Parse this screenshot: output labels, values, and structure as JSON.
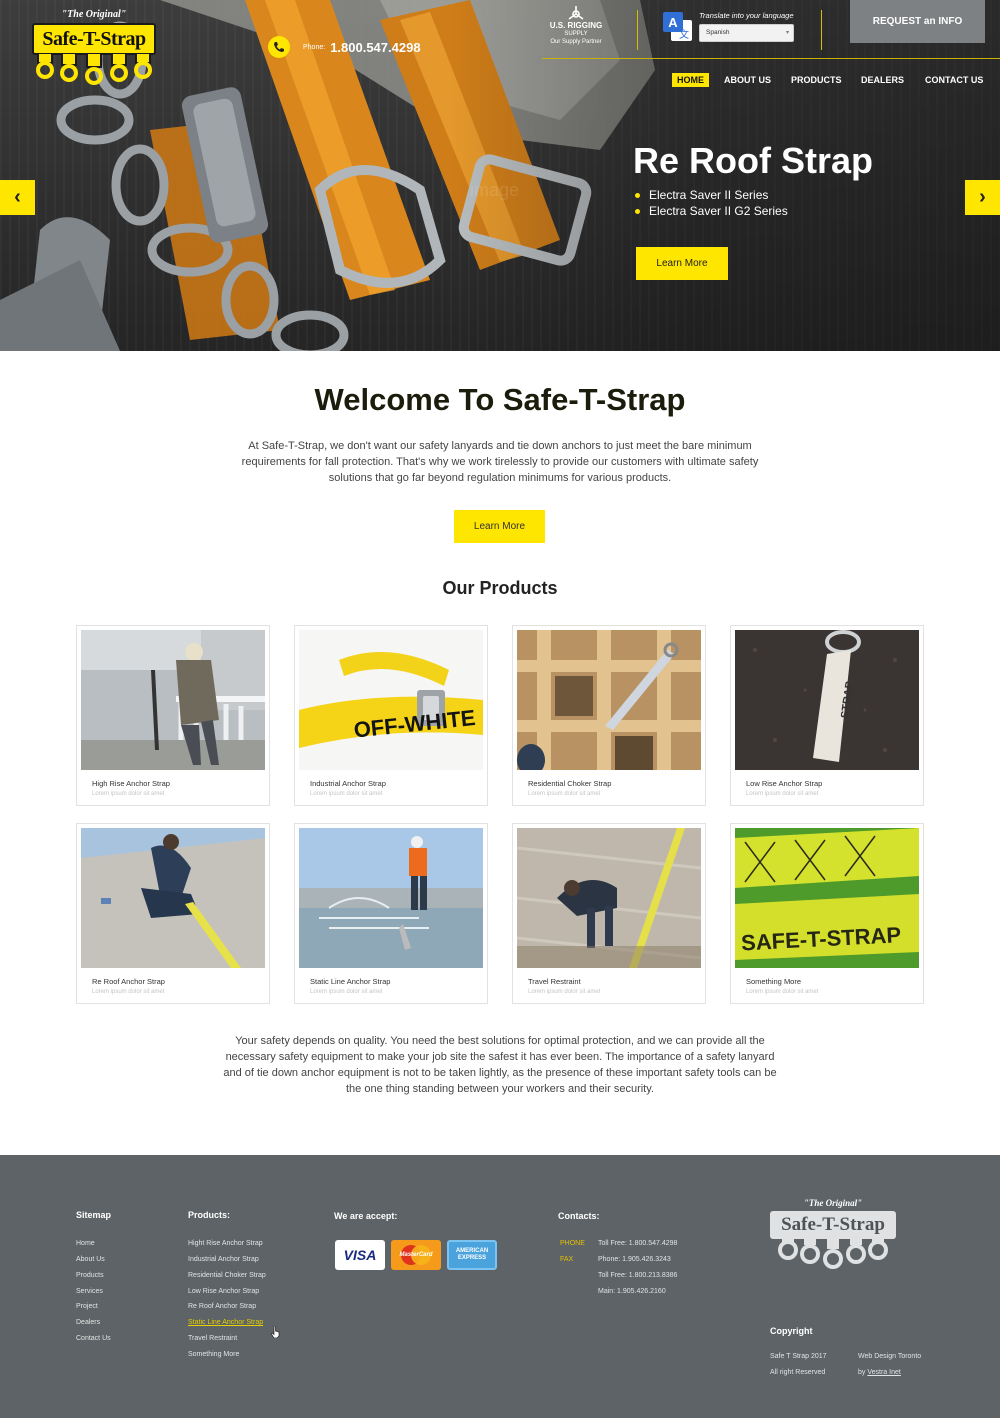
{
  "brand": {
    "tagline": "\"The Original\"",
    "name": "Safe-T-Strap"
  },
  "header": {
    "phone_label": "Phone:",
    "phone_number": "1.800.547.4298",
    "partner_name": "U.S. RIGGING",
    "partner_sub": "SUPPLY",
    "partner_slogan": "Our Supply Partner",
    "translate_label": "Translate into your language",
    "language_selected": "Spanish",
    "request_button": "REQUEST an INFO"
  },
  "nav": {
    "items": [
      {
        "label": "HOME",
        "active": true
      },
      {
        "label": "ABOUT US",
        "active": false
      },
      {
        "label": "PRODUCTS",
        "active": false
      },
      {
        "label": "DEALERS",
        "active": false
      },
      {
        "label": "CONTACT US",
        "active": false
      }
    ]
  },
  "hero": {
    "title": "Re Roof Strap",
    "bullets": [
      "Electra Saver II Series",
      "Electra Saver II G2 Series"
    ],
    "button": "Learn More",
    "watermark": "image",
    "accent": "#ffe600"
  },
  "welcome": {
    "title": "Welcome To Safe-T-Strap",
    "text": "At Safe-T-Strap, we don't want our safety lanyards and tie down anchors to just meet the bare minimum requirements for fall protection. That's why we work tirelessly to provide our customers with ultimate safety solutions that go far beyond regulation minimums for various products.",
    "button": "Learn More"
  },
  "products": {
    "title": "Our Products",
    "items": [
      {
        "title": "High Rise Anchor Strap",
        "subtitle": "Lorem ipsum dolor sit amet"
      },
      {
        "title": "Industrial Anchor Strap",
        "subtitle": "Lorem ipsum dolor sit amet"
      },
      {
        "title": "Residential Choker Strap",
        "subtitle": "Lorem ipsum dolor sit amet"
      },
      {
        "title": "Low Rise Anchor Strap",
        "subtitle": "Lorem ipsum dolor sit amet"
      },
      {
        "title": "Re Roof Anchor Strap",
        "subtitle": "Lorem ipsum dolor sit amet"
      },
      {
        "title": "Static Line Anchor Strap",
        "subtitle": "Lorem ipsum dolor sit amet"
      },
      {
        "title": "Travel Restraint",
        "subtitle": "Lorem ipsum dolor sit amet"
      },
      {
        "title": "Something More",
        "subtitle": "Lorem ipsum dolor sit amet"
      }
    ],
    "strap_text_1": "OFF-WHITE",
    "strap_text_2": "SAFE-T-STRAP",
    "strap_text_3": "STRAP"
  },
  "quality_text": "Your safety depends on quality. You need the best solutions for optimal protection, and we can provide all the necessary safety equipment to make your job site the safest it has ever been. The importance of a safety lanyard and of tie down anchor equipment is not to be taken lightly, as the presence of these important safety tools can be the one thing standing between your workers and their security.",
  "footer": {
    "sitemap_title": "Sitemap",
    "sitemap": [
      "Home",
      "About Us",
      "Products",
      "Services",
      "Project",
      "Dealers",
      "Contact Us"
    ],
    "products_title": "Products:",
    "products": [
      "Hight Rise Anchor Strap",
      "Industrial Anchor Strap",
      "Residential Choker Strap",
      "Low Rise Anchor Strap",
      "Re Roof Anchor Strap",
      "Static Line Anchor Strap",
      "Travel Restraint",
      "Something More"
    ],
    "highlighted_product": "Static Line Anchor Strap",
    "accept_title": "We are accept:",
    "cards": {
      "visa": "VISA",
      "mastercard": "MasterCard",
      "amex_1": "AMERICAN",
      "amex_2": "EXPRESS"
    },
    "contacts_title": "Contacts:",
    "phone_label": "PHONE",
    "fax_label": "FAX",
    "contacts": [
      "Toll Free: 1.800.547.4298",
      "Phone: 1.905.426.3243",
      "Toll Free: 1.800.213.8386",
      "Main: 1.905.426.2160"
    ],
    "logo_tagline": "\"The Original\"",
    "logo_name": "Safe-T-Strap",
    "copyright_title": "Copyright",
    "copyright_line1": "Safe T Strap 2017",
    "copyright_line2": "All right Reserved",
    "credit_line1": "Web Design Toronto",
    "credit_by": "by",
    "credit_link": "Vestra Inet"
  }
}
